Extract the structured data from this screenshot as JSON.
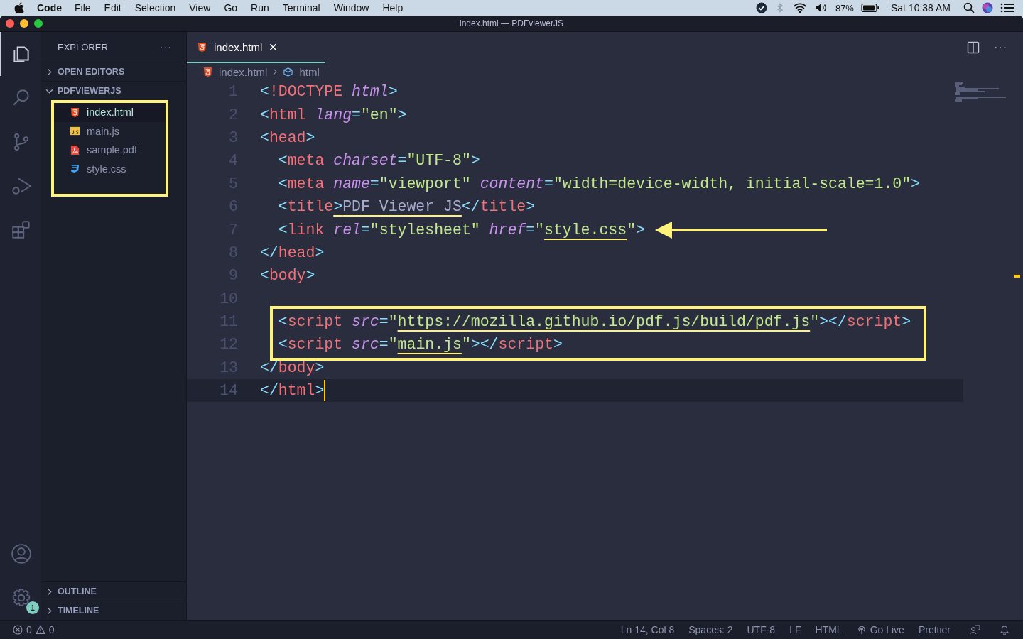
{
  "menubar": {
    "app": "Code",
    "menus": [
      "File",
      "Edit",
      "Selection",
      "View",
      "Go",
      "Run",
      "Terminal",
      "Window",
      "Help"
    ],
    "battery": "87%",
    "clock": "Sat 10:38 AM"
  },
  "window": {
    "title": "index.html — PDFviewerJS"
  },
  "activity_bar": [
    {
      "kind": "files",
      "selected": true
    },
    {
      "kind": "search",
      "selected": false
    },
    {
      "kind": "source-control",
      "selected": false
    },
    {
      "kind": "run",
      "selected": false
    },
    {
      "kind": "extensions",
      "selected": false
    }
  ],
  "activity_bottom": [
    {
      "kind": "account"
    },
    {
      "kind": "settings",
      "badge": "1"
    }
  ],
  "sidebar": {
    "title": "EXPLORER",
    "more": "···",
    "sections": [
      {
        "label": "OPEN EDITORS",
        "expanded": false
      },
      {
        "label": "PDFVIEWERJS",
        "expanded": true,
        "boxed": true,
        "children": [
          {
            "name": "index.html",
            "kind": "html",
            "selected": true
          },
          {
            "name": "main.js",
            "kind": "js",
            "selected": false
          },
          {
            "name": "sample.pdf",
            "kind": "pdf",
            "selected": false
          },
          {
            "name": "style.css",
            "kind": "css",
            "selected": false
          }
        ]
      }
    ],
    "bottom_sections": [
      {
        "label": "OUTLINE",
        "expanded": false
      },
      {
        "label": "TIMELINE",
        "expanded": false
      }
    ]
  },
  "editor": {
    "tabs": [
      {
        "label": "index.html",
        "kind": "html",
        "selected": true,
        "close": "×"
      }
    ],
    "more": "···",
    "breadcrumb": [
      {
        "label": "index.html",
        "kind": "html"
      },
      {
        "label": "html",
        "kind": "element"
      }
    ],
    "lines": [
      {
        "number": "1",
        "boxed": false,
        "arrow": false,
        "current": false,
        "segments": [
          {
            "text": "<!DOCTYPE html>",
            "underlined": false
          }
        ]
      },
      {
        "number": "2",
        "boxed": false,
        "arrow": false,
        "current": false,
        "segments": [
          {
            "text": "<html lang=\"en\">",
            "underlined": false
          }
        ]
      },
      {
        "number": "3",
        "boxed": false,
        "arrow": false,
        "current": false,
        "segments": [
          {
            "text": "<head>",
            "underlined": false
          }
        ]
      },
      {
        "number": "4",
        "boxed": false,
        "arrow": false,
        "current": false,
        "segments": [
          {
            "text": "  <meta charset=\"UTF-8\">",
            "underlined": false
          }
        ]
      },
      {
        "number": "5",
        "boxed": false,
        "arrow": false,
        "current": false,
        "segments": [
          {
            "text": "  <meta name=\"viewport\" content=\"width=device-width, initial-scale=1.0\">",
            "underlined": false
          }
        ]
      },
      {
        "number": "6",
        "boxed": false,
        "arrow": false,
        "current": false,
        "segments": [
          {
            "text": "  <title",
            "underlined": false
          },
          {
            "text": ">PDF Viewer JS",
            "underlined": true
          },
          {
            "text": "</title>",
            "underlined": false
          }
        ]
      },
      {
        "number": "7",
        "boxed": false,
        "arrow": true,
        "current": false,
        "segments": [
          {
            "text": "  <link rel=\"stylesheet\" href=\"",
            "underlined": false
          },
          {
            "text": "style.css",
            "underlined": true
          },
          {
            "text": "\">",
            "underlined": false
          }
        ]
      },
      {
        "number": "8",
        "boxed": false,
        "arrow": false,
        "current": false,
        "segments": [
          {
            "text": "</head>",
            "underlined": false
          }
        ]
      },
      {
        "number": "9",
        "boxed": false,
        "arrow": false,
        "current": false,
        "segments": [
          {
            "text": "<body>",
            "underlined": false
          }
        ]
      },
      {
        "number": "10",
        "boxed": false,
        "arrow": false,
        "current": false
      },
      {
        "number": "11",
        "boxed": true,
        "arrow": false,
        "current": false,
        "segments": [
          {
            "text": "  <script src=\"",
            "underlined": false
          },
          {
            "text": "https://mozilla.github.io/pdf.js/build/pdf.js",
            "underlined": true
          },
          {
            "text": "\"></script>",
            "underlined": false
          }
        ]
      },
      {
        "number": "12",
        "boxed": true,
        "arrow": false,
        "current": false,
        "segments": [
          {
            "text": "  <script src=\"",
            "underlined": false
          },
          {
            "text": "main.js",
            "underlined": true
          },
          {
            "text": "\"></script>",
            "underlined": false
          }
        ]
      },
      {
        "number": "13",
        "boxed": false,
        "arrow": false,
        "current": false,
        "segments": [
          {
            "text": "</body>",
            "underlined": false
          }
        ]
      },
      {
        "number": "14",
        "boxed": false,
        "arrow": false,
        "current": true,
        "segments": [
          {
            "text": "</html>",
            "underlined": false
          }
        ]
      }
    ]
  },
  "status_bar": {
    "errors": "0",
    "warnings": "0",
    "items": [
      {
        "label": "Ln 14, Col 8",
        "kind": "text"
      },
      {
        "label": "Spaces: 2",
        "kind": "text"
      },
      {
        "label": "UTF-8",
        "kind": "text"
      },
      {
        "label": "LF",
        "kind": "text"
      },
      {
        "label": "HTML",
        "kind": "text"
      },
      {
        "label": "Go Live",
        "kind": "live"
      },
      {
        "label": "Prettier",
        "kind": "text"
      },
      {
        "kind": "feedback"
      },
      {
        "kind": "bell"
      }
    ]
  }
}
